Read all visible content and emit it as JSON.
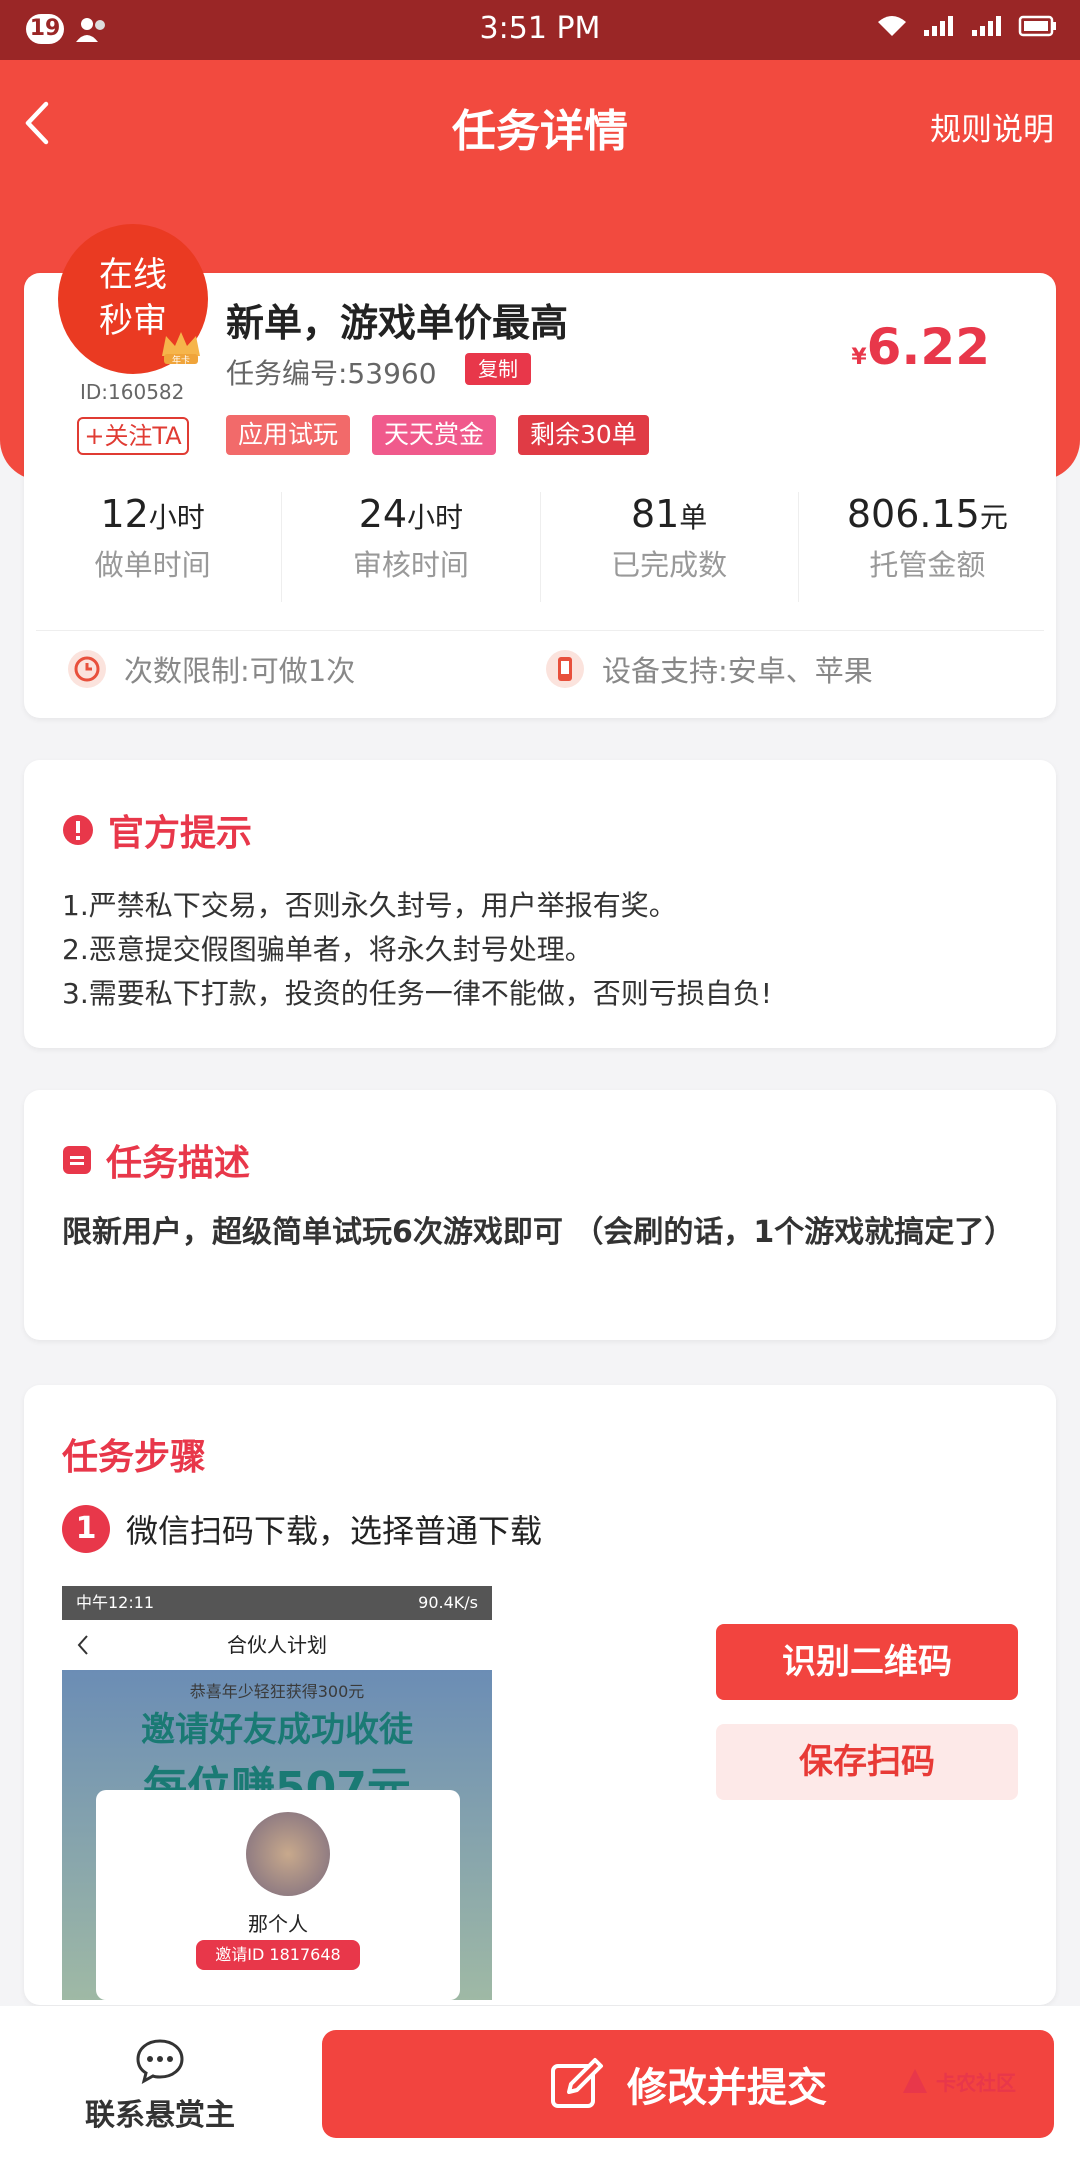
{
  "status_bar": {
    "time": "3:51 PM",
    "badge": "19"
  },
  "header": {
    "title": "任务详情",
    "rules_label": "规则说明"
  },
  "publisher": {
    "avatar_line1": "在线",
    "avatar_line2": "秒审",
    "crown_label": "年卡",
    "id": "ID:160582",
    "follow_label": "+关注TA"
  },
  "task": {
    "name": "新单，游戏单价最高",
    "number": "任务编号:53960",
    "copy_label": "复制",
    "currency": "¥",
    "price": "6.22",
    "tags": [
      {
        "label": "应用试玩",
        "color": "#f26a6a"
      },
      {
        "label": "天天赏金",
        "color": "#f05a8c"
      },
      {
        "label": "剩余30单",
        "color": "#e03b45"
      }
    ]
  },
  "stats": [
    {
      "value": "12",
      "unit": "小时",
      "label": "做单时间"
    },
    {
      "value": "24",
      "unit": "小时",
      "label": "审核时间"
    },
    {
      "value": "81",
      "unit": "单",
      "label": "已完成数"
    },
    {
      "value": "806.15",
      "unit": "元",
      "label": "托管金额"
    }
  ],
  "limits": {
    "times": "次数限制:可做1次",
    "device": "设备支持:安卓、苹果"
  },
  "notice": {
    "title": "官方提示",
    "lines": [
      "1.严禁私下交易，否则永久封号，用户举报有奖。",
      "2.恶意提交假图骗单者，将永久封号处理。",
      "3.需要私下打款，投资的任务一律不能做，否则亏损自负!"
    ]
  },
  "description": {
    "title": "任务描述",
    "text": "限新用户，超级简单试玩6次游戏即可 （会刷的话，1个游戏就搞定了）"
  },
  "steps": {
    "title": "任务步骤",
    "step1": {
      "num": "1",
      "text": "微信扫码下载，选择普通下载"
    },
    "screenshot": {
      "status_time": "中午12:11",
      "status_right": "90.4K/s",
      "nav_title": "合伙人计划",
      "promo_small": "恭喜年少轻狂获得300元",
      "promo_line1": "邀请好友成功收徒",
      "promo_line2": "每位赚507元",
      "user_name": "那个人",
      "invite_id": "邀请ID 1817648"
    },
    "recognize_label": "识别二维码",
    "save_label": "保存扫码"
  },
  "bottom": {
    "contact_label": "联系悬赏主",
    "submit_label": "修改并提交",
    "watermark": "卡农社区"
  },
  "colors": {
    "accent": "#f24a3f",
    "price": "#e8374a"
  }
}
